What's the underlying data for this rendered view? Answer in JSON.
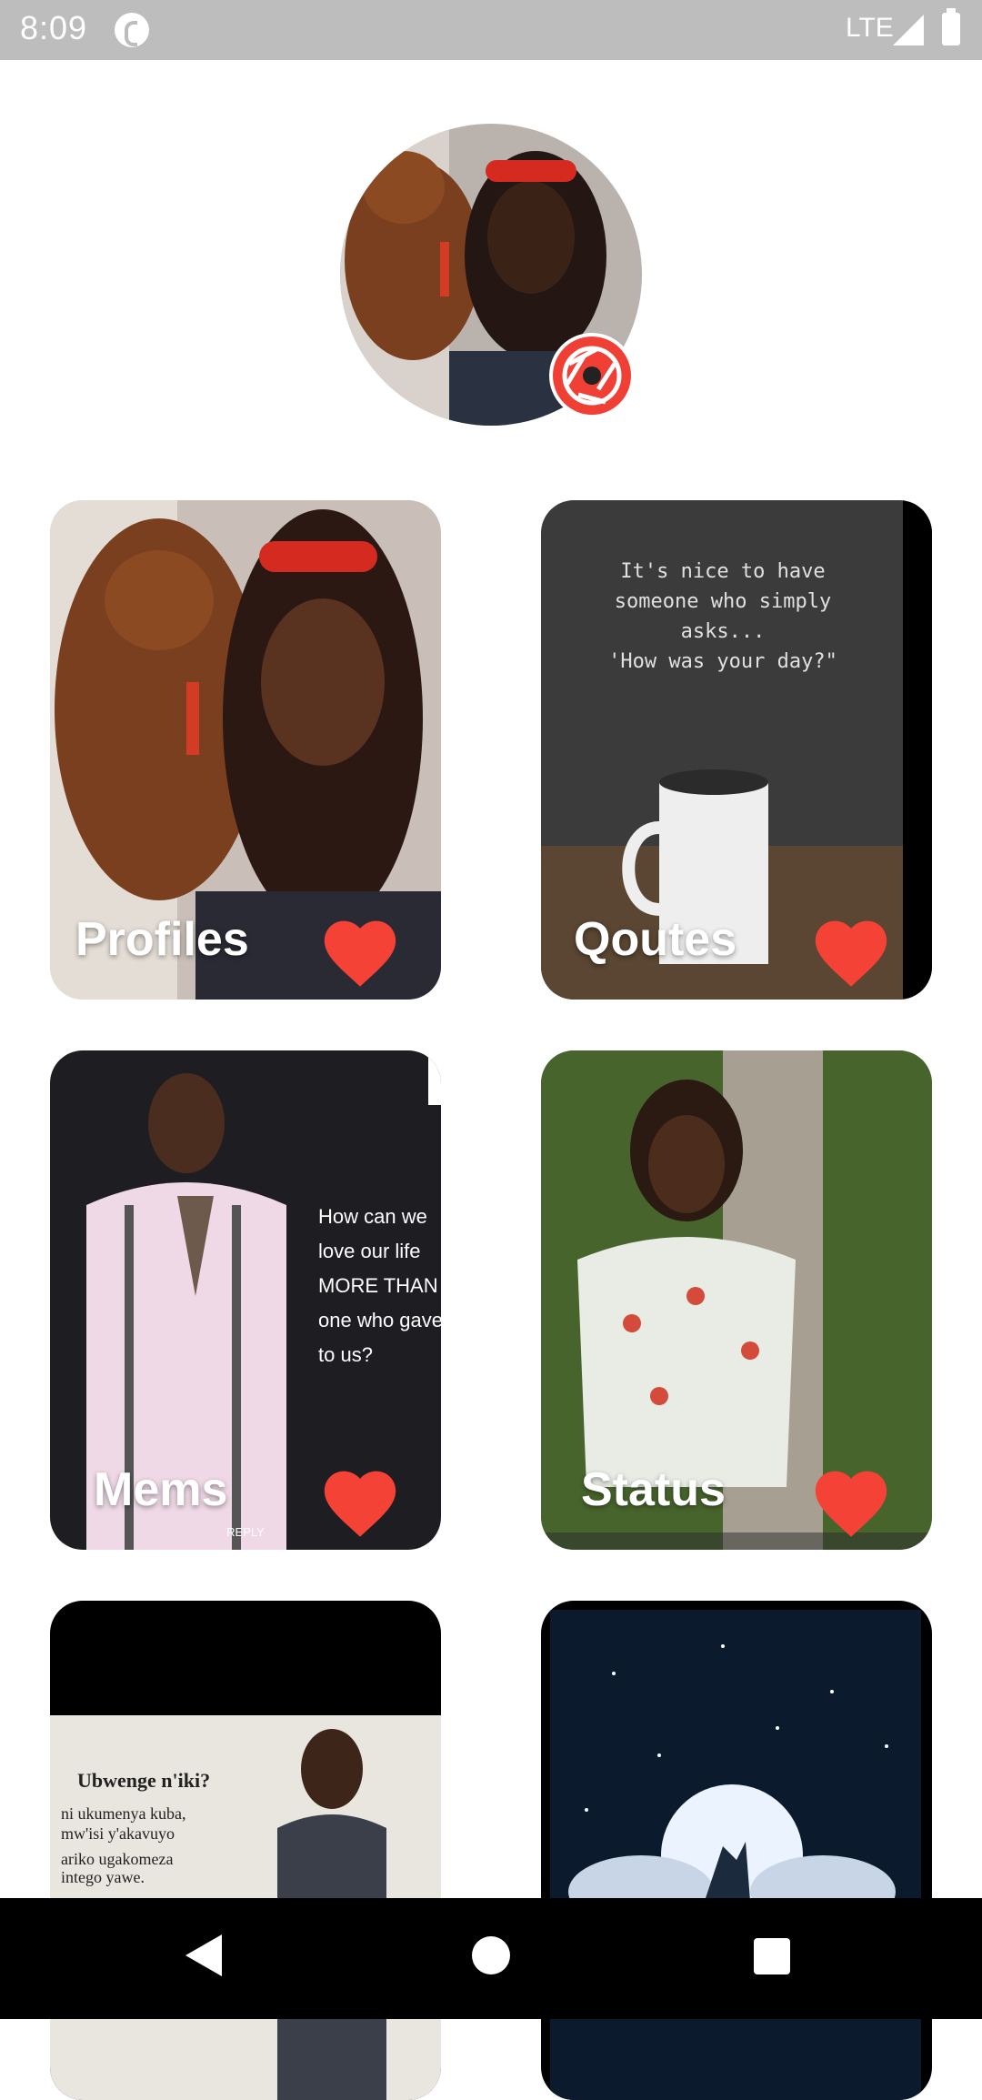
{
  "status_bar": {
    "time": "8:09",
    "network": "LTE"
  },
  "profile": {
    "avatar": "profile-photo",
    "action_icon": "camera-icon"
  },
  "cards": [
    {
      "label": "Profiles",
      "icon": "heart-icon"
    },
    {
      "label": "Qoutes",
      "icon": "heart-icon",
      "image_text": [
        "It's nice to have",
        "someone who simply",
        "asks...",
        "'How was your day?\""
      ]
    },
    {
      "label": "Mems",
      "icon": "heart-icon",
      "image_text": [
        "How can we",
        "love our life",
        "MORE THAN the",
        "one who gave it",
        "to us?"
      ],
      "reply": "REPLY"
    },
    {
      "label": "Status",
      "icon": "heart-icon"
    },
    {
      "label": "",
      "image_text": [
        "Ubwenge n'iki?",
        "ni ukumenya kuba,",
        "mw'isi y'akavuyo",
        "ariko ugakomeza",
        "intego yawe."
      ]
    },
    {
      "label": ""
    }
  ],
  "colors": {
    "accent": "#f44336",
    "camera_badge": "#f03f35",
    "status_bar": "#bdbdbd",
    "nav_bar": "#000000"
  }
}
